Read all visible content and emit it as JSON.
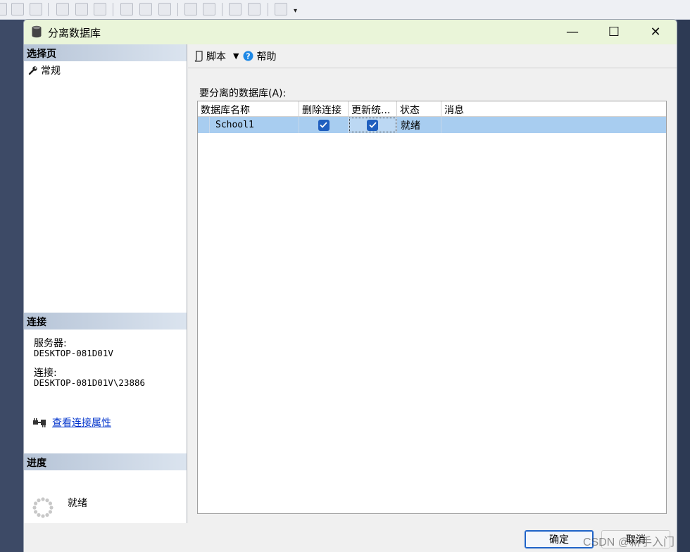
{
  "dialog": {
    "title": "分离数据库",
    "minimize_glyph": "—",
    "maximize_glyph": "☐",
    "close_glyph": "✕"
  },
  "left_panel": {
    "select_page_header": "选择页",
    "pages": [
      {
        "label": "常规",
        "icon": "wrench-icon"
      }
    ],
    "connection_header": "连接",
    "server_label": "服务器:",
    "server_value": "DESKTOP-081D01V",
    "connection_label": "连接:",
    "connection_value": "DESKTOP-081D01V\\23886",
    "view_properties_link": "查看连接属性",
    "progress_header": "进度",
    "progress_status": "就绪"
  },
  "toolbar": {
    "script_label": "脚本",
    "help_label": "帮助"
  },
  "grid": {
    "label": "要分离的数据库(A):",
    "columns": [
      "数据库名称",
      "删除连接",
      "更新统...",
      "状态",
      "消息"
    ],
    "rows": [
      {
        "database_name": "School1",
        "drop_connections": true,
        "update_statistics": true,
        "status": "就绪",
        "message": ""
      }
    ]
  },
  "buttons": {
    "ok_label": "确定",
    "cancel_label": "取消"
  },
  "watermark": "CSDN @新手入门",
  "colors": {
    "title_bar": "#eaf5d9",
    "selected_row": "#a8cdf0",
    "section_header_from": "#b6c4d7",
    "checkbox": "#1f5fbf",
    "link": "#0033cc"
  }
}
